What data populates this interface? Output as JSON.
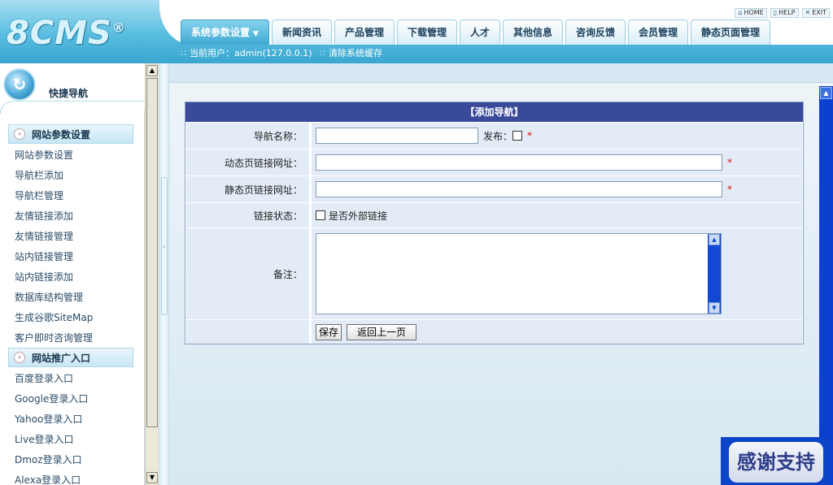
{
  "header": {
    "logo": "8CMS",
    "logo_mark": "®",
    "toplinks": [
      {
        "icon": "home-icon",
        "label": "HOME"
      },
      {
        "icon": "help-icon",
        "label": "HELP"
      },
      {
        "icon": "exit-icon",
        "label": "EXIT"
      }
    ],
    "tabs": [
      {
        "label": "系统参数设置",
        "active": true
      },
      {
        "label": "新闻资讯"
      },
      {
        "label": "产品管理"
      },
      {
        "label": "下载管理"
      },
      {
        "label": "人才"
      },
      {
        "label": "其他信息"
      },
      {
        "label": "咨询反馈"
      },
      {
        "label": "会员管理"
      },
      {
        "label": "静态页面管理"
      }
    ],
    "status": {
      "current_user": "当前用户：admin(127.0.0.1)",
      "clear_cache": "清除系统缓存"
    }
  },
  "sidebar": {
    "title": "快捷导航",
    "sections": [
      {
        "title": "网站参数设置",
        "items": [
          "网站参数设置",
          "导航栏添加",
          "导航栏管理",
          "友情链接添加",
          "友情链接管理",
          "站内链接管理",
          "站内链接添加",
          "数据库结构管理",
          "生成谷歌SiteMap",
          "客户即时咨询管理"
        ]
      },
      {
        "title": "网站推广入口",
        "items": [
          "百度登录入口",
          "Google登录入口",
          "Yahoo登录入口",
          "Live登录入口",
          "Dmoz登录入口",
          "Alexa登录入口"
        ]
      }
    ]
  },
  "form": {
    "title": "【添加导航】",
    "name_label": "导航名称：",
    "name_value": "",
    "publish_label": "发布：",
    "dynamic_label": "动态页链接网址：",
    "dynamic_value": "",
    "static_label": "静态页链接网址：",
    "static_value": "",
    "link_status_label": "链接状态：",
    "external_label": "是否外部链接",
    "note_label": "备注：",
    "required_mark": "*",
    "save_label": "保存",
    "back_label": "返回上一页"
  },
  "badge": "感谢支持",
  "colors": {
    "header_blue": "#3aa6cf",
    "form_title_bg": "#3a4a9a",
    "form_row_bg": "#e3ecf6",
    "scrollbar_blue": "#0b40d0",
    "required_red": "#d01010"
  }
}
